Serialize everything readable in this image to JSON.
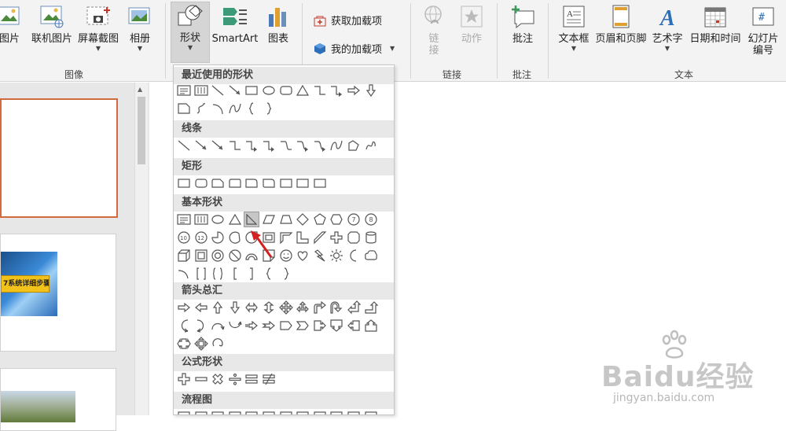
{
  "ribbon": {
    "groups": {
      "images": "图像",
      "links": "链接",
      "comments": "批注",
      "text": "文本"
    },
    "buttons": {
      "picture": "图片",
      "online_picture": "联机图片",
      "screenshot": "屏幕截图",
      "album": "相册",
      "shapes": "形状",
      "smartart": "SmartArt",
      "chart": "图表",
      "get_addins": "获取加载项",
      "my_addins": "我的加载项",
      "link": "链\n接",
      "action": "动作",
      "comment": "批注",
      "textbox": "文本框",
      "header_footer": "页眉和页脚",
      "wordart": "艺术字",
      "datetime": "日期和时间",
      "slide_number_1": "幻灯片",
      "slide_number_2": "编号"
    }
  },
  "shapes_menu": {
    "sections": {
      "recent": "最近使用的形状",
      "lines": "线条",
      "rectangles": "矩形",
      "basic": "基本形状",
      "arrows": "箭头总汇",
      "equation": "公式形状",
      "flowchart": "流程图"
    },
    "highlighted_shape": "right-triangle"
  },
  "left_pane": {
    "thumb_banner_text": "7系统详细步骤"
  },
  "watermark": {
    "logo": "Baidu经验",
    "url": "jingyan.baidu.com"
  },
  "colors": {
    "ribbon_bg": "#f3f3f3",
    "selected_thumb_border": "#d2693f",
    "annotation_arrow": "#d42020",
    "section_header_bg": "#e8e8e8"
  }
}
